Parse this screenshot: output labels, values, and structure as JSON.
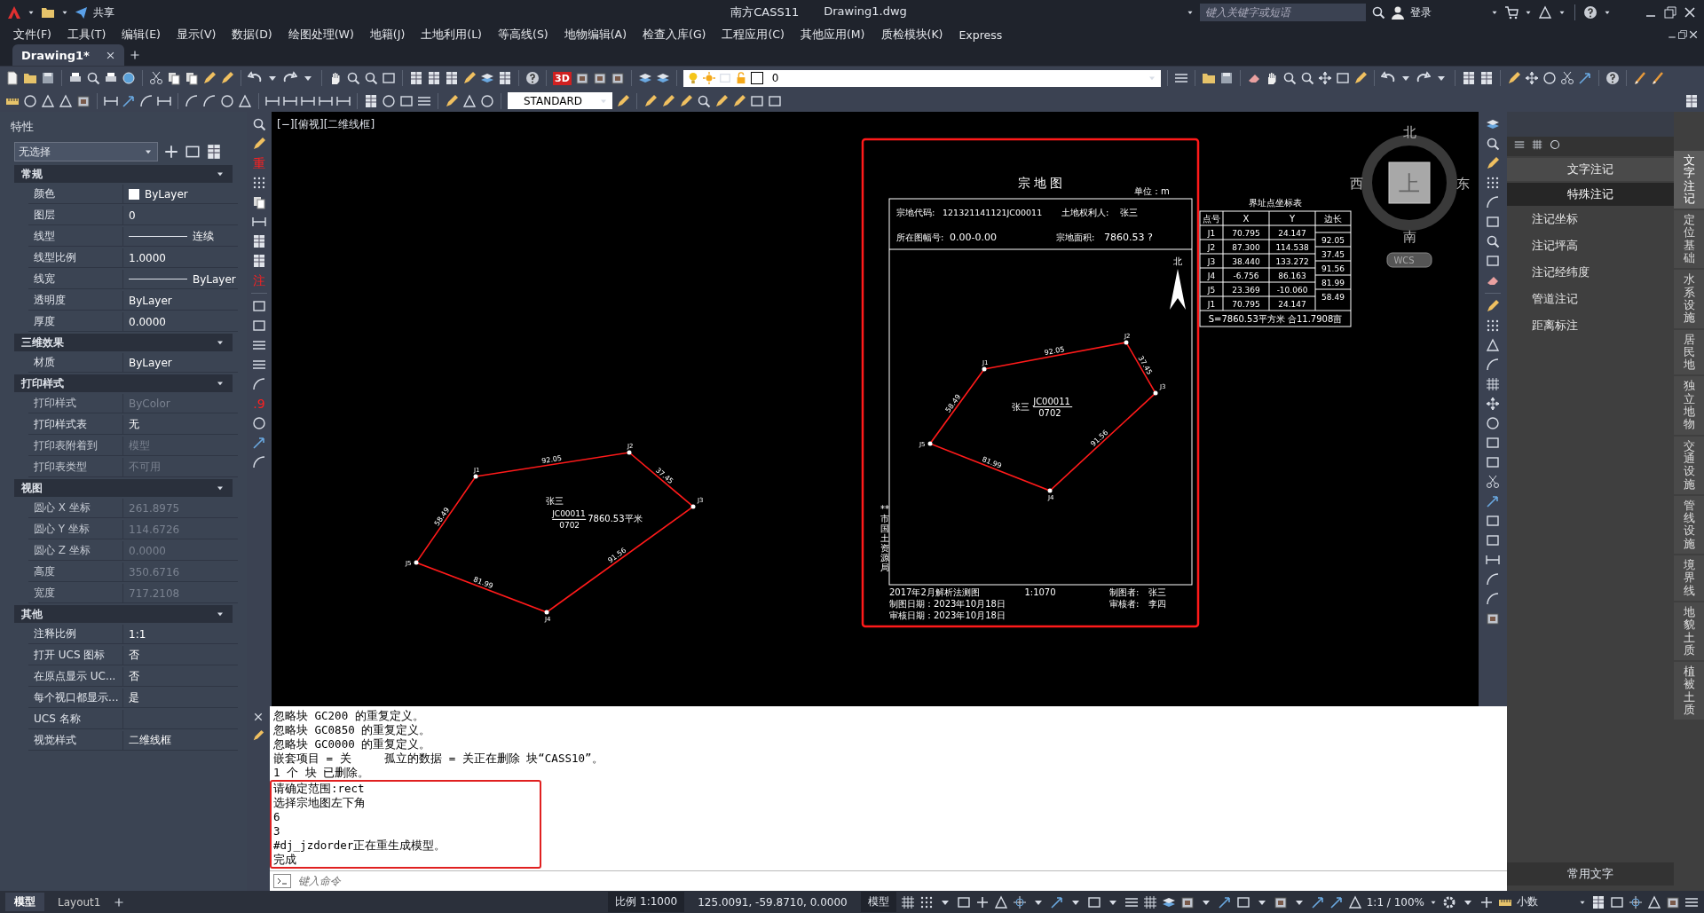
{
  "title_bar": {
    "share": "共享",
    "app": "南方CASS11",
    "file": "Drawing1.dwg",
    "search": {
      "placeholder": "键入关键字或短语"
    },
    "login": "登录"
  },
  "menu": [
    "文件(F)",
    "工具(T)",
    "编辑(E)",
    "显示(V)",
    "数据(D)",
    "绘图处理(W)",
    "地籍(J)",
    "土地利用(L)",
    "等高线(S)",
    "地物编辑(A)",
    "检查入库(G)",
    "工程应用(C)",
    "其他应用(M)",
    "质检模块(K)",
    "Express"
  ],
  "document_tabs": [
    {
      "label": "Drawing1*",
      "selected": true
    }
  ],
  "toolbar": {
    "badge": "3D",
    "layer": "0",
    "text_style": "STANDARD"
  },
  "left_tool_glyphs": [
    "重",
    "注",
    ".9"
  ],
  "properties": {
    "title": "特性",
    "selection": "无选择",
    "sections": [
      {
        "title": "常规",
        "expanded": true,
        "rows": [
          {
            "label": "颜色",
            "value": "ByLayer",
            "kind": "swatch",
            "disabled": false
          },
          {
            "label": "图层",
            "value": "0",
            "kind": "plain",
            "disabled": false
          },
          {
            "label": "线型",
            "value": "连续",
            "kind": "line",
            "disabled": false
          },
          {
            "label": "线型比例",
            "value": "1.0000",
            "kind": "plain",
            "disabled": false
          },
          {
            "label": "线宽",
            "value": "ByLayer",
            "kind": "line",
            "disabled": false
          },
          {
            "label": "透明度",
            "value": "ByLayer",
            "kind": "plain",
            "disabled": false
          },
          {
            "label": "厚度",
            "value": "0.0000",
            "kind": "plain",
            "disabled": false
          }
        ]
      },
      {
        "title": "三维效果",
        "expanded": true,
        "rows": [
          {
            "label": "材质",
            "value": "ByLayer",
            "kind": "plain",
            "disabled": false
          }
        ]
      },
      {
        "title": "打印样式",
        "expanded": true,
        "rows": [
          {
            "label": "打印样式",
            "value": "ByColor",
            "kind": "plain",
            "disabled": true
          },
          {
            "label": "打印样式表",
            "value": "无",
            "kind": "plain",
            "disabled": false
          },
          {
            "label": "打印表附着到",
            "value": "模型",
            "kind": "plain",
            "disabled": true
          },
          {
            "label": "打印表类型",
            "value": "不可用",
            "kind": "plain",
            "disabled": true
          }
        ]
      },
      {
        "title": "视图",
        "expanded": true,
        "rows": [
          {
            "label": "圆心 X 坐标",
            "value": "261.8975",
            "kind": "plain",
            "disabled": true
          },
          {
            "label": "圆心 Y 坐标",
            "value": "114.6726",
            "kind": "plain",
            "disabled": true
          },
          {
            "label": "圆心 Z 坐标",
            "value": "0.0000",
            "kind": "plain",
            "disabled": true
          },
          {
            "label": "高度",
            "value": "350.6716",
            "kind": "plain",
            "disabled": true
          },
          {
            "label": "宽度",
            "value": "717.2108",
            "kind": "plain",
            "disabled": true
          }
        ]
      },
      {
        "title": "其他",
        "expanded": true,
        "rows": [
          {
            "label": "注释比例",
            "value": "1:1",
            "kind": "plain",
            "disabled": false
          },
          {
            "label": "打开 UCS 图标",
            "value": "否",
            "kind": "plain",
            "disabled": false
          },
          {
            "label": "在原点显示 UC...",
            "value": "否",
            "kind": "plain",
            "disabled": false
          },
          {
            "label": "每个视口都显示...",
            "value": "是",
            "kind": "plain",
            "disabled": false
          },
          {
            "label": "UCS 名称"
          },
          {
            "label": "视觉样式",
            "value": "二维线框",
            "kind": "plain",
            "disabled": false
          }
        ]
      }
    ]
  },
  "canvas": {
    "view_label": "[−][俯视][二维线框]",
    "viewcube": {
      "north": "北",
      "south": "南",
      "west": "西",
      "east": "东",
      "face": "上",
      "ucs": "WCS"
    },
    "loose_parcel": {
      "points": [
        "J1",
        "J2",
        "J3",
        "J4",
        "J5"
      ],
      "edges": [
        "92.05",
        "37.45",
        "91.56",
        "81.99",
        "58.49"
      ],
      "owner": "张三",
      "code": "JC00011",
      "number": "0702",
      "area": "7860.53平米"
    },
    "sheet": {
      "highlighted": true,
      "title": "宗 地 图",
      "unit": "单位：m",
      "fields": [
        {
          "label": "宗地代码:",
          "value": "121321141121JC00011"
        },
        {
          "label": "土地权利人:",
          "value": "张三"
        },
        {
          "label": "所在图幅号:",
          "value": "0.00-0.00"
        },
        {
          "label": "宗地面积:",
          "value": "7860.53 ?"
        }
      ],
      "north": "北",
      "parcel": {
        "points": [
          "J1",
          "J2",
          "J3",
          "J4",
          "J5"
        ],
        "edges": [
          "92.05",
          "37.45",
          "91.56",
          "81.99",
          "58.49"
        ],
        "owner": "张三",
        "code": "JC00011",
        "number": "0702"
      },
      "authority": "**市国土资源局",
      "survey": "2017年2月解析法测图",
      "scale": "1:1070",
      "drafter": {
        "label": "制图者:",
        "value": "张三"
      },
      "checker": {
        "label": "审核者:",
        "value": "李四"
      },
      "draft_date": "制图日期：2023年10月18日",
      "check_date": "审核日期：2023年10月18日"
    },
    "coordinate_table": {
      "title": "界址点坐标表",
      "columns": [
        "点号",
        "X",
        "Y",
        "边长"
      ],
      "rows": [
        [
          "J1",
          "70.795",
          "24.147"
        ],
        [
          "J2",
          "87.300",
          "114.538"
        ],
        [
          "J3",
          "38.440",
          "133.272"
        ],
        [
          "J4",
          "-6.756",
          "86.163"
        ],
        [
          "J5",
          "23.369",
          "-10.060"
        ],
        [
          "J1",
          "70.795",
          "24.147"
        ]
      ],
      "edges": [
        "92.05",
        "37.45",
        "91.56",
        "81.99",
        "58.49"
      ],
      "footer": "S=7860.53平方米 合11.7908亩"
    }
  },
  "command": {
    "lines": [
      "忽略块 GC200 的重复定义。",
      "忽略块 GC0850 的重复定义。",
      "忽略块 GC0000 的重复定义。",
      "嵌套项目 = 关     孤立的数据 = 关正在删除 块“CASS10”。",
      "1 个 块 已删除。"
    ],
    "framed_lines": [
      "请确定范围:rect",
      "选择宗地图左下角",
      "6",
      "3",
      "#dj_jzdorder正在重生成模型。",
      "完成"
    ],
    "placeholder": "键入命令"
  },
  "layout_tabs": [
    {
      "label": "模型",
      "selected": true
    },
    {
      "label": "Layout1",
      "selected": false
    }
  ],
  "status_bar": {
    "scale_label": "比例",
    "scale": "1:1000",
    "coords": "125.0091, -59.8710, 0.0000",
    "space": "模型",
    "annotation_scale": "1:1 / 100%",
    "units": "小数"
  },
  "right_panel": {
    "sections": [
      {
        "title": "文字注记",
        "expanded": false
      },
      {
        "title": "特殊注记",
        "expanded": true,
        "items": [
          "注记坐标",
          "注记坪高",
          "注记经纬度",
          "管道注记",
          "距离标注"
        ]
      }
    ],
    "footer": "常用文字",
    "side_tabs": [
      {
        "label": "文字注记",
        "selected": true
      },
      {
        "label": "定位基础",
        "selected": false
      },
      {
        "label": "水系设施",
        "selected": false
      },
      {
        "label": "居民地",
        "selected": false
      },
      {
        "label": "独立地物",
        "selected": false
      },
      {
        "label": "交通设施",
        "selected": false
      },
      {
        "label": "管线设施",
        "selected": false
      },
      {
        "label": "境界线",
        "selected": false
      },
      {
        "label": "地貌土质",
        "selected": false
      },
      {
        "label": "植被土质",
        "selected": false
      }
    ]
  }
}
